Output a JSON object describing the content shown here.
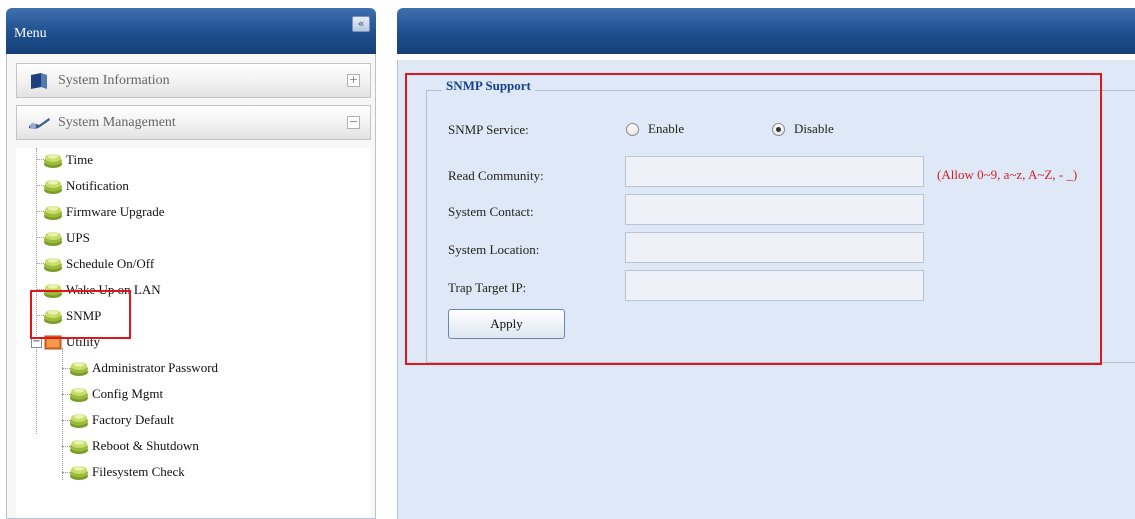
{
  "menu": {
    "title": "Menu",
    "collapse_glyph": "«",
    "sections": [
      {
        "label": "System Information",
        "toggle": "+",
        "icon": "book-icon"
      },
      {
        "label": "System Management",
        "toggle": "−",
        "icon": "wrench-icon"
      }
    ],
    "tree": {
      "items": [
        "Time",
        "Notification",
        "Firmware Upgrade",
        "UPS",
        "Schedule On/Off",
        "Wake Up on LAN",
        "SNMP"
      ],
      "utility": {
        "label": "Utility",
        "expander": "−",
        "children": [
          "Administrator Password",
          "Config Mgmt",
          "Factory Default",
          "Reboot & Shutdown",
          "Filesystem Check"
        ]
      }
    }
  },
  "snmp": {
    "legend": "SNMP Support",
    "service_label": "SNMP Service:",
    "enable_label": "Enable",
    "disable_label": "Disable",
    "selected": "Disable",
    "read_community_label": "Read Community:",
    "read_community_value": "",
    "read_community_hint": "(Allow 0~9, a~z, A~Z, - _)",
    "system_contact_label": "System Contact:",
    "system_contact_value": "",
    "system_location_label": "System Location:",
    "system_location_value": "",
    "trap_target_label": "Trap Target IP:",
    "trap_target_value": "",
    "apply_label": "Apply"
  },
  "colors": {
    "header_blue": "#1f4f8f",
    "content_bg": "#dfe8f6",
    "legend_text": "#15428b",
    "highlight_red": "#e0161b",
    "hint_red": "#cc2222"
  }
}
